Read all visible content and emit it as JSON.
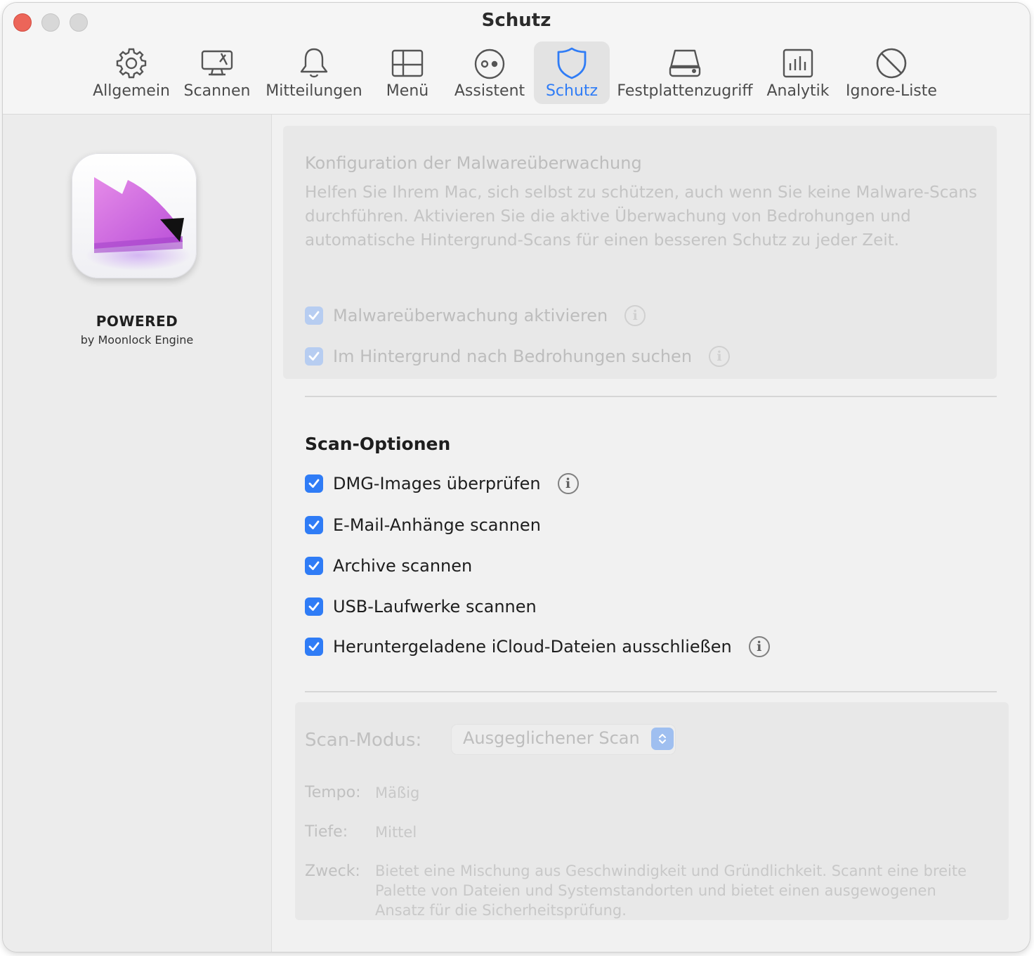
{
  "window": {
    "title": "Schutz"
  },
  "toolbar": {
    "tabs": [
      {
        "label": "Allgemein",
        "icon": "gear-icon"
      },
      {
        "label": "Scannen",
        "icon": "monitor-scan-icon"
      },
      {
        "label": "Mitteilungen",
        "icon": "bell-icon"
      },
      {
        "label": "Menü",
        "icon": "menu-window-icon"
      },
      {
        "label": "Assistent",
        "icon": "assistant-face-icon"
      },
      {
        "label": "Schutz",
        "icon": "shield-icon",
        "active": true
      },
      {
        "label": "Festplattenzugriff",
        "icon": "disk-drive-icon"
      },
      {
        "label": "Analytik",
        "icon": "chart-icon"
      },
      {
        "label": "Ignore-Liste",
        "icon": "prohibited-icon"
      }
    ],
    "active_color": "#2f7cf6"
  },
  "sidebar": {
    "powered": "POWERED",
    "powered_by": "by Moonlock Engine"
  },
  "monitoring": {
    "title": "Konfiguration der Malwareüberwachung",
    "description": "Helfen Sie Ihrem Mac, sich selbst zu schützen, auch wenn Sie keine Malware-Scans durchführen. Aktivieren Sie die aktive Überwachung von Bedrohungen und automatische Hintergrund-Scans für einen besseren Schutz zu jeder Zeit.",
    "options": [
      {
        "label": "Malwareüberwachung aktivieren",
        "checked": true,
        "enabled": false,
        "info": true
      },
      {
        "label": "Im Hintergrund nach Bedrohungen suchen",
        "checked": true,
        "enabled": false,
        "info": true
      }
    ]
  },
  "scan_options": {
    "title": "Scan-Optionen",
    "options": [
      {
        "label": "DMG-Images überprüfen",
        "checked": true,
        "info": true
      },
      {
        "label": "E-Mail-Anhänge scannen",
        "checked": true,
        "info": false
      },
      {
        "label": "Archive scannen",
        "checked": true,
        "info": false
      },
      {
        "label": "USB-Laufwerke scannen",
        "checked": true,
        "info": false
      },
      {
        "label": "Heruntergeladene iCloud-Dateien ausschließen",
        "checked": true,
        "info": true
      }
    ]
  },
  "scan_mode": {
    "label": "Scan-Modus:",
    "selected": "Ausgeglichener Scan",
    "tempo_label": "Tempo:",
    "tempo_value": "Mäßig",
    "depth_label": "Tiefe:",
    "depth_value": "Mittel",
    "purpose_label": "Zweck:",
    "purpose_value": "Bietet eine Mischung aus Geschwindigkeit und Gründlichkeit. Scannt eine breite Palette von Dateien und Systemstandorten und bietet einen ausgewogenen Ansatz für die Sicherheitsprüfung."
  }
}
